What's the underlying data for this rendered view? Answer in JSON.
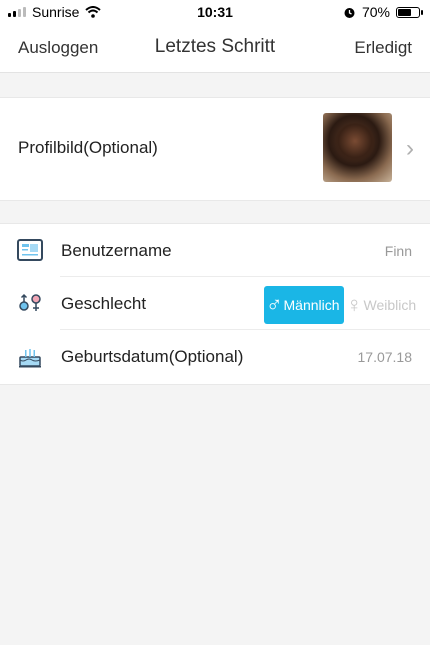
{
  "status_bar": {
    "carrier": "Sunrise",
    "time": "10:31",
    "battery_percent": "70%",
    "battery_level": 0.7
  },
  "nav": {
    "left": "Ausloggen",
    "title": "Letztes Schritt",
    "right": "Erledigt"
  },
  "profile": {
    "label": "Profilbild(Optional)",
    "chevron": "›"
  },
  "rows": [
    {
      "icon": "id-card-icon",
      "label": "Benutzername",
      "value": "Finn"
    },
    {
      "icon": "gender-icon",
      "label": "Geschlecht"
    },
    {
      "icon": "birthday-cake-icon",
      "label": "Geburtsdatum(Optional)",
      "value": "17.07.18"
    }
  ],
  "gender": {
    "male_symbol": "♂",
    "male_label": "Männlich",
    "female_symbol": "♀",
    "female_label": "Weiblich",
    "selected": "male"
  },
  "colors": {
    "accent": "#1ab6e6",
    "background": "#f4f4f4"
  }
}
